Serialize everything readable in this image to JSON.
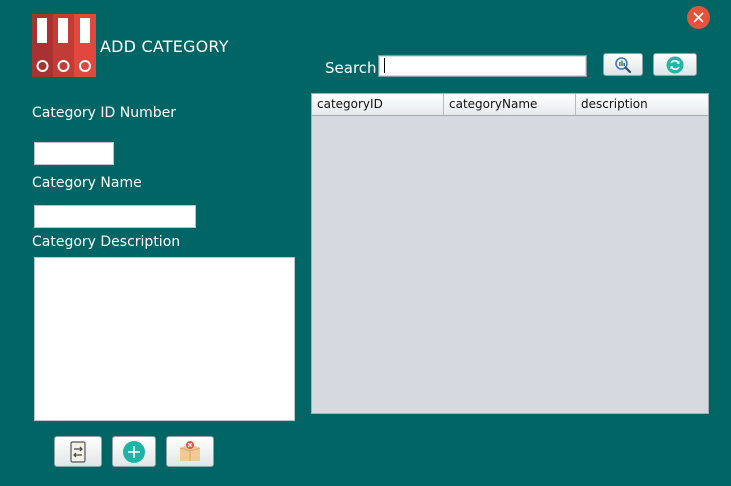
{
  "header": {
    "title": "ADD CATEGORY",
    "logo_icon": "binders-icon"
  },
  "window": {
    "close_icon": "close-icon",
    "close_color": "#e5533d"
  },
  "form": {
    "id_label": "Category ID Number",
    "id_value": "",
    "name_label": "Category Name",
    "name_value": "",
    "description_label": "Category Description",
    "description_value": ""
  },
  "search": {
    "label": "Search",
    "value": "",
    "search_icon": "search-icon",
    "refresh_icon": "refresh-icon"
  },
  "table": {
    "columns": [
      "categoryID",
      "categoryName",
      "description"
    ],
    "rows": []
  },
  "actions": {
    "update_icon": "update-icon",
    "add_icon": "add-icon",
    "delete_icon": "delete-box-icon"
  },
  "colors": {
    "background": "#026565",
    "accent_red": "#e5533d",
    "table_bg": "#d6d9e0"
  }
}
